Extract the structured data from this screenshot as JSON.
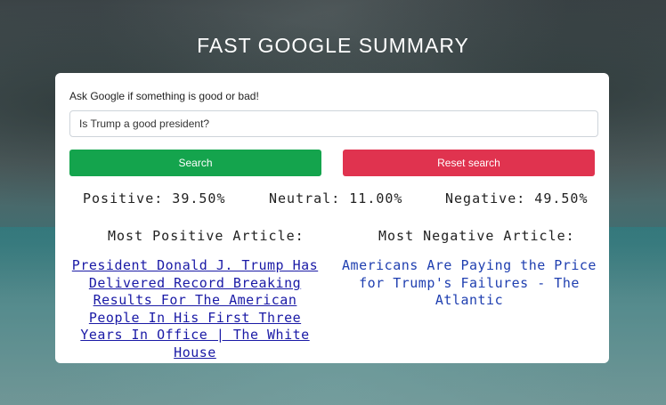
{
  "header": {
    "title": "FAST GOOGLE SUMMARY"
  },
  "search": {
    "prompt": "Ask Google if something is good or bad!",
    "value": "Is Trump a good president?",
    "search_label": "Search",
    "reset_label": "Reset search"
  },
  "results": {
    "positive": "Positive: 39.50%",
    "neutral": "Neutral: 11.00%",
    "negative": "Negative: 49.50%",
    "most_positive_heading": "Most Positive Article:",
    "most_negative_heading": "Most Negative Article:",
    "most_positive_title": "President Donald J. Trump Has Delivered Record Breaking Results For The American People In His First Three Years In Office | The White House",
    "most_negative_title": "Americans Are Paying the Price for Trump's Failures - The Atlantic"
  },
  "colors": {
    "search_button": "#14a44d",
    "reset_button": "#e0334f",
    "link": "#1a1aa6"
  }
}
